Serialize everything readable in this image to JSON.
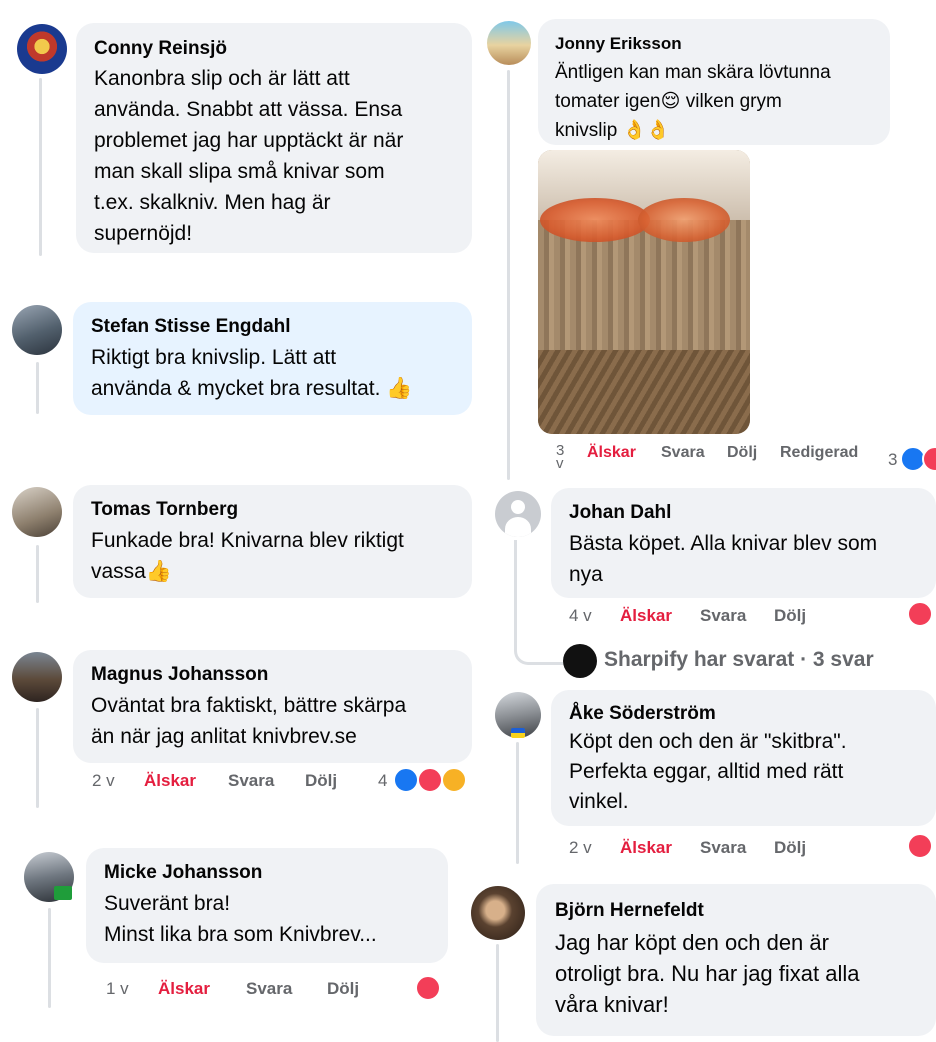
{
  "left_comments": [
    {
      "author": "Conny Reinsjö",
      "text": "Kanonbra slip och är lätt att\nanvända. Snabbt att vässa. Ensa\nproblemet jag har upptäckt är när\nman skall slipa små knivar som\nt.ex. skalkniv. Men hag är\nsupernöjd!"
    },
    {
      "author": "Stefan Stisse Engdahl",
      "text": "Riktigt bra knivslip. Lätt att\nanvända & mycket bra resultat.",
      "emoji": "👍"
    },
    {
      "author": "Tomas Tornberg",
      "text": "Funkade bra! Knivarna blev riktigt\nvassa",
      "emoji": "👍"
    },
    {
      "author": "Magnus Johansson",
      "text": "Oväntat bra faktiskt, bättre skärpa\nän när jag anlitat knivbrev.se",
      "time": "2 v",
      "love": "Älskar",
      "reply": "Svara",
      "hide": "Dölj",
      "react_count": "4"
    },
    {
      "author": "Micke Johansson",
      "text": "Suveränt bra!\nMinst lika bra som Knivbrev...",
      "time": "1 v",
      "love": "Älskar",
      "reply": "Svara",
      "hide": "Dölj"
    }
  ],
  "right_comments": [
    {
      "author": "Jonny Eriksson",
      "text": "Äntligen kan man skära lövtunna\ntomater igen",
      "emoji1": "😌",
      "text2": " vilken grym\nknivslip ",
      "emoji2": "👌👌",
      "time": "3\nv",
      "love": "Älskar",
      "reply": "Svara",
      "hide": "Dölj",
      "edited": "Redigerad",
      "react_count": "3"
    },
    {
      "author": "Johan Dahl",
      "text": "Bästa köpet. Alla knivar blev som\nnya",
      "time": "4 v",
      "love": "Älskar",
      "reply": "Svara",
      "hide": "Dölj"
    },
    {
      "author": "Åke Söderström",
      "text": "Köpt den och den är \"skitbra\".\nPerfekta eggar, alltid med rätt\nvinkel.",
      "time": "2 v",
      "love": "Älskar",
      "reply": "Svara",
      "hide": "Dölj"
    },
    {
      "author": "Björn Hernefeldt",
      "text": "Jag har köpt den och den är\notroligt bra. Nu har jag fixat alla\nvåra knivar!"
    }
  ],
  "replies_link": {
    "page_name": "Sharpify",
    "text": "Sharpify har svarat · 3 svar"
  },
  "colors": {
    "bubble": "#f0f2f5",
    "highlight": "#e7f3ff",
    "love": "#e41e3f",
    "meta": "#65676b"
  }
}
